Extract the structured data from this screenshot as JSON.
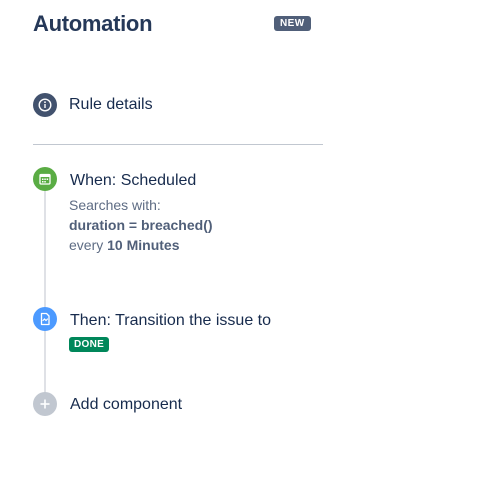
{
  "header": {
    "title": "Automation",
    "badge": "NEW"
  },
  "rule_details": {
    "label": "Rule details",
    "icon": "info-icon"
  },
  "trigger": {
    "label": "When: Scheduled",
    "icon": "calendar-icon",
    "color": "#5aac44",
    "searches_label": "Searches with:",
    "jql": "duration = breached()",
    "every_prefix": "every",
    "interval": "10 Minutes"
  },
  "action": {
    "label": "Then: Transition the issue to",
    "icon": "transition-icon",
    "color": "#4c9aff",
    "status": "DONE",
    "status_color": "#00875a"
  },
  "add_component": {
    "label": "Add component",
    "icon": "plus-icon"
  }
}
